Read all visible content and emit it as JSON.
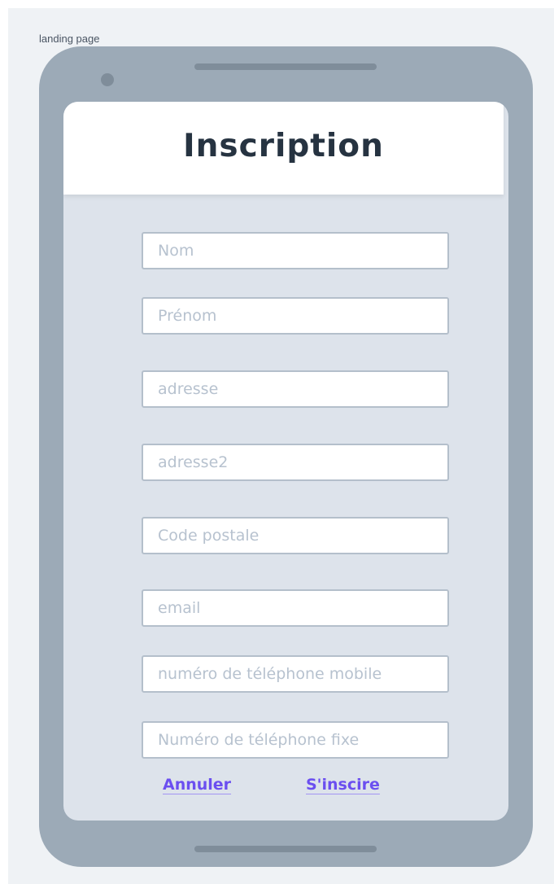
{
  "frame_label": "landing page",
  "form": {
    "title": "Inscription",
    "fields": [
      {
        "name": "nom",
        "placeholder": "Nom"
      },
      {
        "name": "prenom",
        "placeholder": "Prénom"
      },
      {
        "name": "adresse",
        "placeholder": "adresse"
      },
      {
        "name": "adresse2",
        "placeholder": "adresse2"
      },
      {
        "name": "code-postale",
        "placeholder": "Code postale"
      },
      {
        "name": "email",
        "placeholder": "email"
      },
      {
        "name": "telephone-mobile",
        "placeholder": "numéro de téléphone mobile"
      },
      {
        "name": "telephone-fixe",
        "placeholder": "Numéro de téléphone fixe"
      }
    ],
    "cancel_label": "Annuler",
    "submit_label": "S'inscire"
  },
  "colors": {
    "background": "#eff2f5",
    "phone_body": "#9caab7",
    "screen": "#dde3eb",
    "title_text": "#263341",
    "link": "#6b4ff0"
  }
}
